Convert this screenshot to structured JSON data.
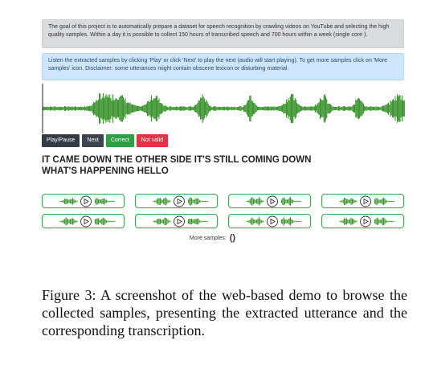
{
  "notice": "The goal of this project is to automatically prepare a dataset for speech recognition by crawling videos on YouTube and selecting the high quality samples. Within a day it is possible to collect 150 hours of transcribed speech and 700 hours within a week (single core ).",
  "instructions": "Listen the extracted samples by clicking 'Play' or click 'Next' to play the next (audio will start playing). To get more samples click on 'More samples' icon. Disclaimer: some utterances might contain obscene lexicon or disturbing material.",
  "controls": {
    "play_pause": "Play/Pause",
    "next": "Next",
    "correct": "Correct",
    "not_valid": "Not valid"
  },
  "transcript": "IT CAME DOWN THE OTHER SIDE IT'S STILL COMING DOWN WHAT'S HAPPENING HELLO",
  "samples": [
    {
      "icon": "play-icon"
    },
    {
      "icon": "play-icon"
    },
    {
      "icon": "play-icon"
    },
    {
      "icon": "play-icon"
    },
    {
      "icon": "play-icon"
    },
    {
      "icon": "play-icon"
    },
    {
      "icon": "play-icon"
    },
    {
      "icon": "play-icon"
    }
  ],
  "more_samples_label": "More samples:",
  "more_samples_icon": "refresh-icon",
  "caption": "Figure 3:   A screenshot of the web-based demo to browse the collected samples, presenting the extracted utterance and the corresponding transcription.",
  "colors": {
    "waveform": "#2c8a1e",
    "sample_border": "#3fa34d",
    "correct": "#2ea043",
    "not_valid": "#dc3545"
  }
}
